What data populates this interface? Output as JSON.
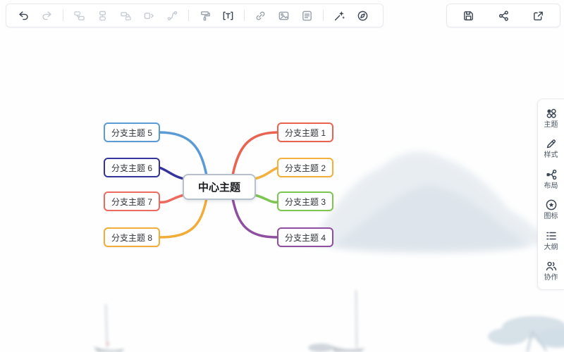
{
  "toolbar": {
    "left_items": [
      "undo",
      "redo",
      "insert-sibling-node",
      "insert-child-node",
      "insert-parent-node",
      "expand-node",
      "relation-line",
      "format-painter",
      "text-tool",
      "hyperlink",
      "image",
      "note",
      "ai-magic",
      "theme-switch"
    ],
    "right_items": [
      "save",
      "share",
      "export"
    ]
  },
  "sidebar": {
    "items": [
      {
        "icon": "theme-icon",
        "label": "主题"
      },
      {
        "icon": "style-icon",
        "label": "样式"
      },
      {
        "icon": "layout-icon",
        "label": "布局"
      },
      {
        "icon": "icon-library-icon",
        "label": "图标"
      },
      {
        "icon": "outline-icon",
        "label": "大纲"
      },
      {
        "icon": "collaboration-icon",
        "label": "协作"
      }
    ]
  },
  "mindmap": {
    "center": {
      "label": "中心主题",
      "border_color": "#b7c1ce"
    },
    "branches": [
      {
        "label": "分支主题 1",
        "color": "#ea6350",
        "side": "right"
      },
      {
        "label": "分支主题 2",
        "color": "#f3b03c",
        "side": "right"
      },
      {
        "label": "分支主题 3",
        "color": "#7cc550",
        "side": "right"
      },
      {
        "label": "分支主题 4",
        "color": "#8f4fa0",
        "side": "right"
      },
      {
        "label": "分支主题 5",
        "color": "#5b9bd5",
        "side": "left"
      },
      {
        "label": "分支主题 6",
        "color": "#34349c",
        "side": "left"
      },
      {
        "label": "分支主题 7",
        "color": "#ed6a5e",
        "side": "left"
      },
      {
        "label": "分支主题 8",
        "color": "#f2ac38",
        "side": "left"
      }
    ]
  }
}
